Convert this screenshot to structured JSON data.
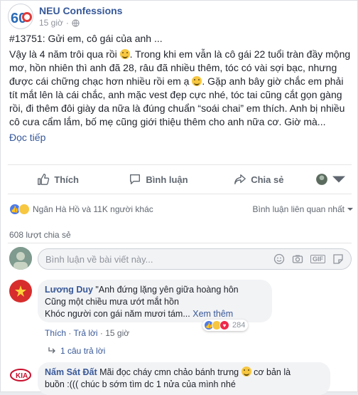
{
  "post": {
    "page_name": "NEU Confessions",
    "time": "15 giờ",
    "avatar_label": "60",
    "paragraphs": [
      "#13751: Gửi em, cô gái của anh ...",
      "Vậy là 4 năm trôi qua rồi",
      "Trong khi em vẫn là cô gái 22 tuổi tràn đầy mộng mơ, hồn nhiên thì anh đã 28, râu đã nhiều thêm, tóc có vài sợi bạc, nhưng được cái chững chạc hơn nhiều rồi em ạ",
      "Gặp anh bây giờ chắc em phải tít mắt lên là cái chắc, anh mặc vest đẹp cực nhé, tóc tai cũng cắt gọn gàng rồi, đi thêm đôi giày da nữa là đúng chuẩn “soái chai” em thích. Anh bị nhiều cô cưa cẩm lắm, bố mẹ cũng giới thiệu thêm cho anh nữa cơ. Giờ mà..."
    ],
    "see_more": "Đọc tiếp"
  },
  "actions": {
    "like": "Thích",
    "comment": "Bình luận",
    "share": "Chia sẻ"
  },
  "reactions": {
    "summary": "Ngân Hà Hồ và 11K người khác",
    "sort": "Bình luận liên quan nhất"
  },
  "shares": "608 lượt chia sẻ",
  "composer": {
    "placeholder": "Bình luận về bài viết này...",
    "gif": "GIF"
  },
  "comments": [
    {
      "name": "Lương Duy",
      "text_lines": [
        "\"Anh đứng lặng yên giữa hoàng hôn",
        "Cũng một chiều mưa ướt mắt hồn",
        "Khóc người con gái năm mươi tám..."
      ],
      "see_more": "Xem thêm",
      "like": "Thích",
      "reply": "Trả lời",
      "time": "15 giờ",
      "reaction_count": "284",
      "replies": "1 câu trả lời"
    },
    {
      "name": "Nấm Sát Đất",
      "text_lines": [
        "Mãi đọc cháy cmn chảo bánh trưng",
        "cơ bản là",
        "buồn :((( chúc b sớm tìm dc 1 nửa của mình nhé"
      ]
    }
  ]
}
